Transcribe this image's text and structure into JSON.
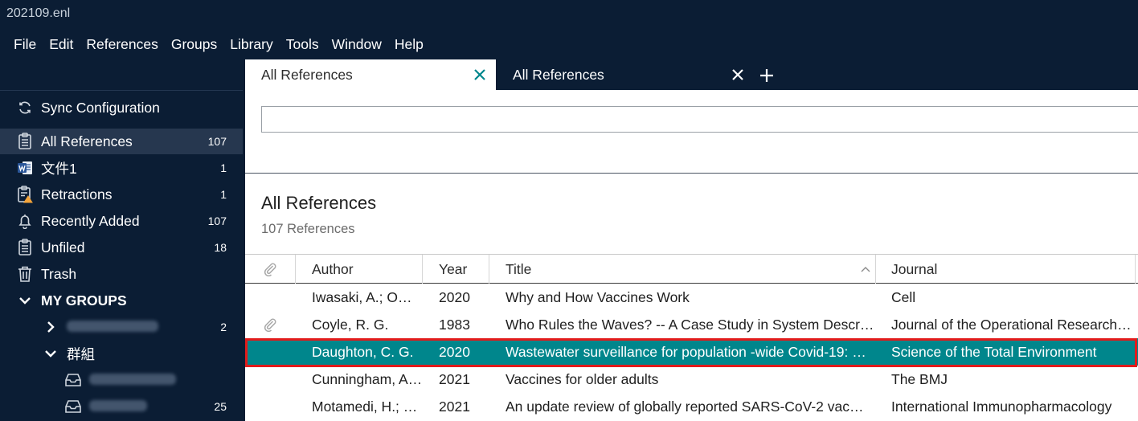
{
  "app": {
    "title": "202109.enl"
  },
  "menu": [
    "File",
    "Edit",
    "References",
    "Groups",
    "Library",
    "Tools",
    "Window",
    "Help"
  ],
  "sidebar": {
    "sync": "Sync Configuration",
    "items": [
      {
        "label": "All References",
        "count": "107",
        "icon": "clipboard-icon"
      },
      {
        "label": "文件1",
        "count": "1",
        "icon": "word-document-icon"
      },
      {
        "label": "Retractions",
        "count": "1",
        "icon": "clipboard-warning-icon"
      },
      {
        "label": "Recently Added",
        "count": "107",
        "icon": "bell-icon"
      },
      {
        "label": "Unfiled",
        "count": "18",
        "icon": "clipboard-icon"
      },
      {
        "label": "Trash",
        "count": "",
        "icon": "trash-icon"
      }
    ],
    "my_groups": "MY GROUPS",
    "groups": [
      {
        "count": "2"
      },
      {
        "label": "群組"
      },
      {
        "count": ""
      },
      {
        "count": "25"
      }
    ]
  },
  "tabs": [
    {
      "label": "All References"
    },
    {
      "label": "All References"
    }
  ],
  "search": {
    "value": ""
  },
  "library": {
    "title": "All References",
    "subtitle": "107 References"
  },
  "table": {
    "columns": [
      "Author",
      "Year",
      "Title",
      "Journal"
    ],
    "rows": [
      {
        "attachment": false,
        "author": "Iwasaki, A.; Om…",
        "year": "2020",
        "title": "Why and How Vaccines Work",
        "journal": "Cell"
      },
      {
        "attachment": true,
        "author": "Coyle, R. G.",
        "year": "1983",
        "title": "Who Rules the Waves? -- A Case Study in System Descri…",
        "journal": "Journal of the Operational Research …"
      },
      {
        "attachment": false,
        "author": "Daughton, C. G.",
        "year": "2020",
        "title": "Wastewater surveillance for population -wide Covid-19: …",
        "journal": "Science of the Total Environment",
        "selected": true
      },
      {
        "attachment": false,
        "author": "Cunningham, A…",
        "year": "2021",
        "title": "Vaccines for older adults",
        "journal": "The BMJ"
      },
      {
        "attachment": false,
        "author": "Motamedi, H.; …",
        "year": "2021",
        "title": "An update review of globally reported SARS-CoV-2 vac…",
        "journal": "International Immunopharmacology"
      }
    ]
  },
  "colors": {
    "chrome": "#0b1d34",
    "selected_row": "#00868c",
    "highlight": "#e21b1b",
    "tab_close_active": "#00868c"
  }
}
